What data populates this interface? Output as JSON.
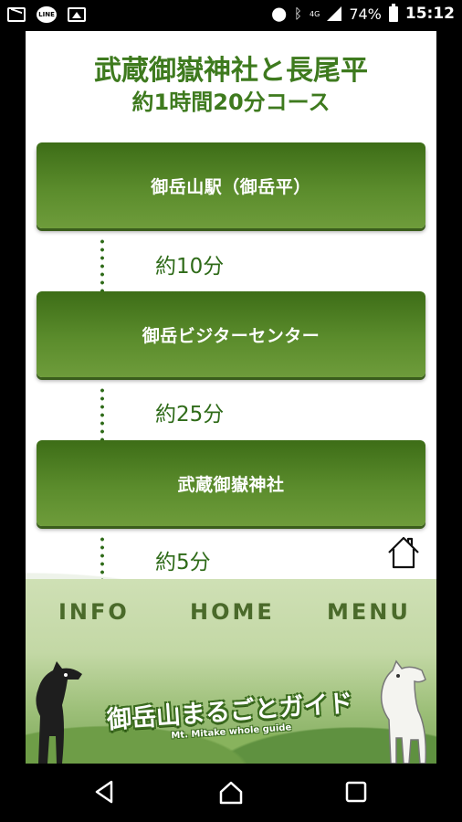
{
  "status_bar": {
    "left_icons": [
      "mail-icon",
      "line-app-icon",
      "image-icon"
    ],
    "line_label": "LINE",
    "signal_label": "4G",
    "battery": "74%",
    "time": "15:12"
  },
  "page": {
    "title_line1": "武蔵御嶽神社と長尾平",
    "title_line2": "約1時間20分コース"
  },
  "route": {
    "stops": [
      {
        "label": "御岳山駅（御岳平）"
      },
      {
        "label": "御岳ビジターセンター"
      },
      {
        "label": "武蔵御嶽神社"
      }
    ],
    "legs": [
      {
        "time": "約10分"
      },
      {
        "time": "約25分"
      },
      {
        "time": "約5分"
      }
    ]
  },
  "footer": {
    "nav": {
      "info": "INFO",
      "home": "HOME",
      "menu": "MENU"
    },
    "banner_title": "御岳山まるごとガイド",
    "banner_subtitle": "Mt. Mitake whole guide"
  },
  "system_nav": [
    "back-icon",
    "home-icon",
    "recents-icon"
  ],
  "colors": {
    "accent_green": "#3e7a1e",
    "button_green": "#5b8c2c"
  }
}
